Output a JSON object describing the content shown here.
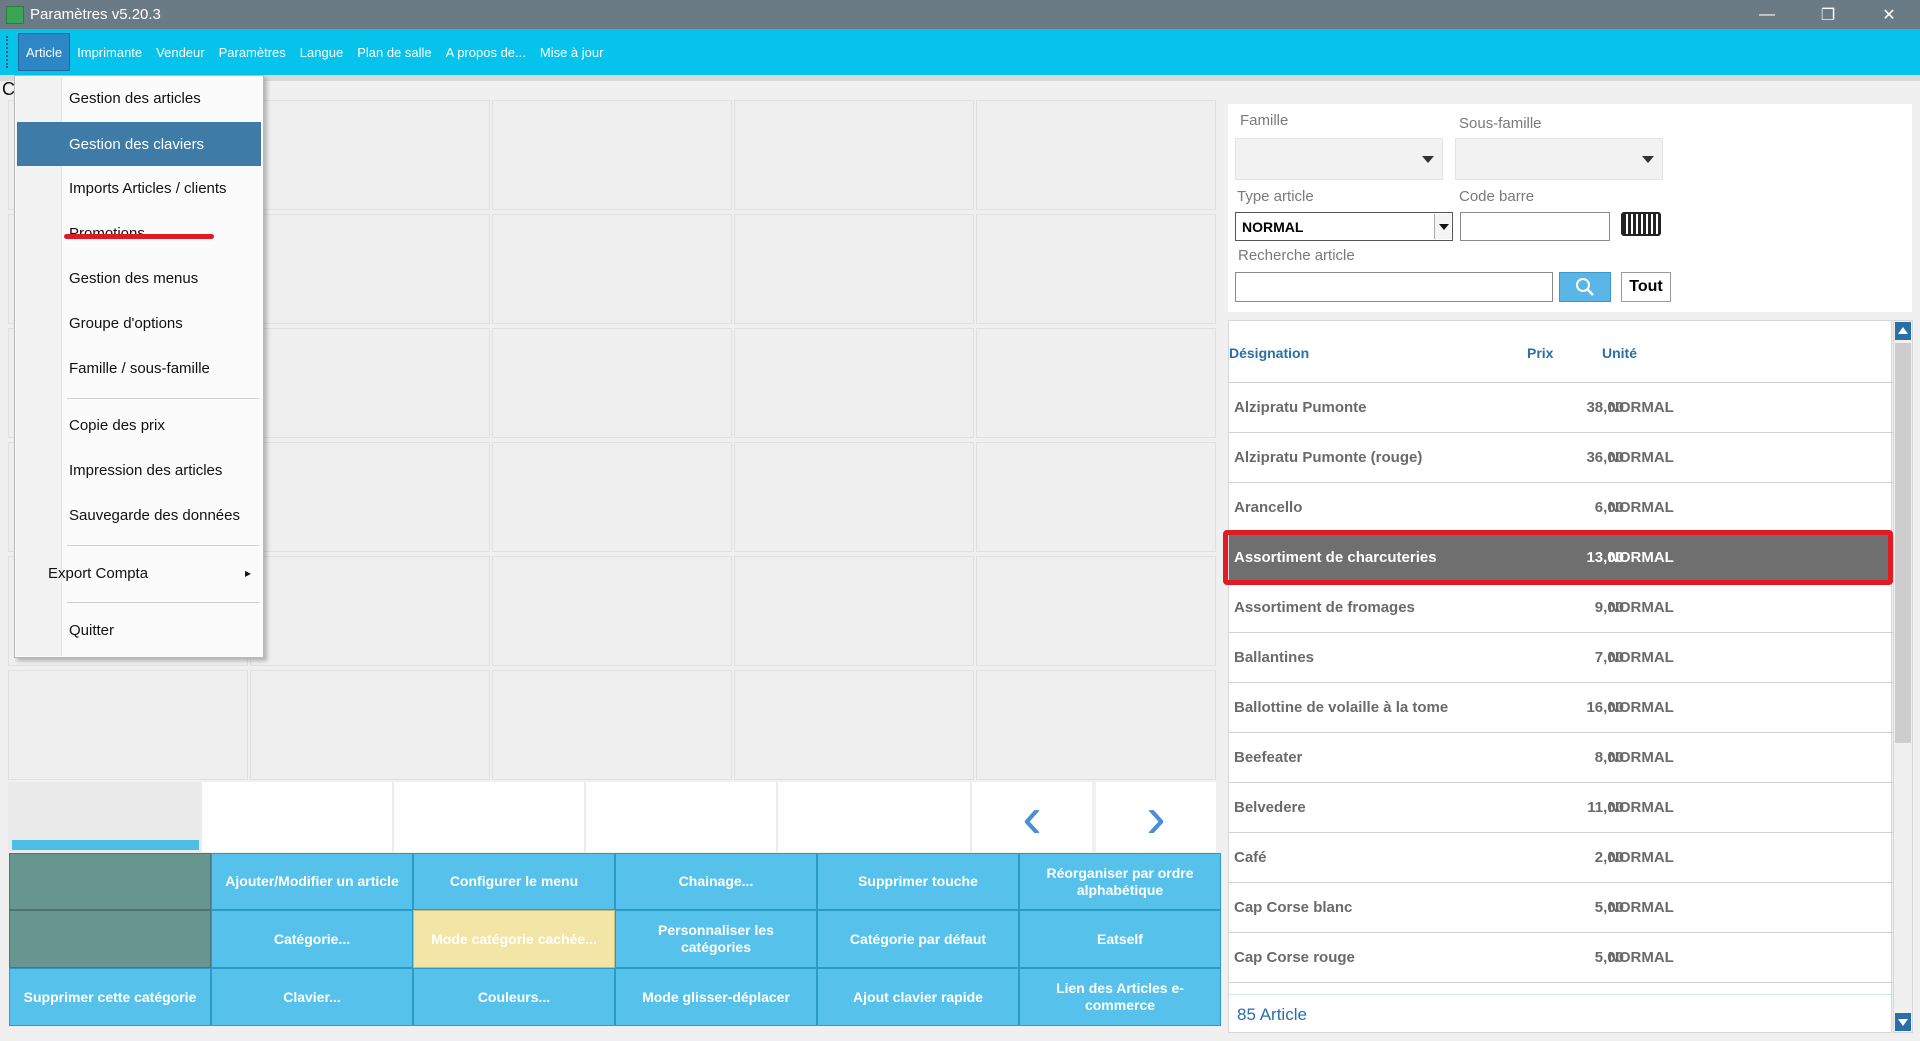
{
  "window": {
    "title": "Paramètres v5.20.3",
    "controls": {
      "minimize": "—",
      "restore": "❐",
      "close": "✕"
    }
  },
  "menubar": {
    "items": [
      "Article",
      "Imprimante",
      "Vendeur",
      "Paramètres",
      "Langue",
      "Plan de salle",
      "A propos de...",
      "Mise à jour"
    ],
    "active": "Article"
  },
  "dropdown": {
    "items": [
      "Gestion des articles",
      "Gestion des claviers",
      "Imports Articles / clients",
      "Promotions",
      "Gestion des menus",
      "Groupe d'options",
      "Famille / sous-famille",
      "Copie des prix",
      "Impression des articles",
      "Sauvegarde des données",
      "Export Compta",
      "Quitter"
    ],
    "selected": "Gestion des claviers",
    "submenu_arrow": "▸"
  },
  "background_letter": "C",
  "nav": {
    "prev": "‹",
    "next": "›"
  },
  "buttons": {
    "ajouter": "Ajouter/Modifier un article",
    "configurer": "Configurer le menu",
    "chainage": "Chainage...",
    "supprimer_touche": "Supprimer touche",
    "reorganiser": "Réorganiser par ordre alphabétique",
    "categorie": "Catégorie...",
    "mode_cachee": "Mode catégorie cachée...",
    "personnaliser": "Personnaliser les catégories",
    "categorie_defaut": "Catégorie par défaut",
    "eatself": "Eatself",
    "supprimer_categorie": "Supprimer cette catégorie",
    "clavier": "Clavier...",
    "couleurs": "Couleurs...",
    "glisser": "Mode glisser-déplacer",
    "ajout_rapide": "Ajout clavier rapide",
    "lien": "Lien des Articles e-commerce"
  },
  "filters": {
    "famille_label": "Famille",
    "sous_famille_label": "Sous-famille",
    "type_label": "Type article",
    "type_value": "NORMAL",
    "code_label": "Code barre",
    "recherche_label": "Recherche article",
    "tout": "Tout"
  },
  "list": {
    "headers": {
      "designation": "Désignation",
      "prix": "Prix",
      "unite": "Unité"
    },
    "rows": [
      {
        "d": "Alzipratu Pumonte",
        "p": "38,00",
        "u": "NORMAL"
      },
      {
        "d": "Alzipratu Pumonte (rouge)",
        "p": "36,00",
        "u": "NORMAL"
      },
      {
        "d": "Arancello",
        "p": "6,00",
        "u": "NORMAL"
      },
      {
        "d": "Assortiment de charcuteries",
        "p": "13,00",
        "u": "NORMAL"
      },
      {
        "d": "Assortiment de fromages",
        "p": "9,00",
        "u": "NORMAL"
      },
      {
        "d": "Ballantines",
        "p": "7,00",
        "u": "NORMAL"
      },
      {
        "d": "Ballottine de volaille à la tome",
        "p": "16,00",
        "u": "NORMAL"
      },
      {
        "d": "Beefeater",
        "p": "8,00",
        "u": "NORMAL"
      },
      {
        "d": "Belvedere",
        "p": "11,00",
        "u": "NORMAL"
      },
      {
        "d": "Café",
        "p": "2,00",
        "u": "NORMAL"
      },
      {
        "d": "Cap Corse blanc",
        "p": "5,00",
        "u": "NORMAL"
      },
      {
        "d": "Cap Corse rouge",
        "p": "5,00",
        "u": "NORMAL"
      }
    ],
    "selected_row": "Assortiment de charcuteries",
    "count": "85 Article"
  },
  "colors": {
    "menubar": "#05c3ea",
    "accent": "#56c2ec",
    "highlight": "#e01b24"
  }
}
